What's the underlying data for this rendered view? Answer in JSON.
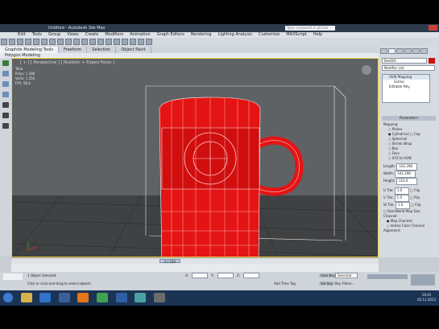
{
  "window": {
    "title": "Untitled - Autodesk 3ds Max",
    "search_placeholder": "Type a keyword or phrase"
  },
  "menu": [
    "Edit",
    "Tools",
    "Group",
    "Views",
    "Create",
    "Modifiers",
    "Animation",
    "Graph Editors",
    "Rendering",
    "Lighting Analysis",
    "Customize",
    "MAXScript",
    "Help"
  ],
  "ribbon": {
    "tabs": [
      "Graphite Modeling Tools",
      "Freeform",
      "Selection",
      "Object Paint"
    ],
    "subtab": "Polygon Modeling"
  },
  "viewport": {
    "label": "[ + ] [ Perspective ] [ Realistic + Edged Faces ]",
    "stats": [
      "Total",
      "Polys: 1 288",
      "Verts: 1 256",
      "FPS: 58.4"
    ]
  },
  "command_panel": {
    "object_name": "Box001",
    "modifier_list": "Modifier List",
    "stack": [
      "UVW Mapping",
      "Gizmo",
      "Editable Poly"
    ],
    "rollout": "Parameters",
    "mapping_title": "Mapping:",
    "mapping_options": [
      "Planar",
      "Cylindrical",
      "Cap",
      "Spherical",
      "Shrink Wrap",
      "Box",
      "Face",
      "XYZ to UVW"
    ],
    "length_label": "Length:",
    "length_value": "102.298",
    "width_label": "Width:",
    "width_value": "102.298",
    "height_label": "Height:",
    "height_value": "110.0",
    "u_tile_label": "U Tile:",
    "u_tile_value": "1.0",
    "v_tile_label": "V Tile:",
    "v_tile_value": "1.0",
    "w_tile_label": "W Tile:",
    "w_tile_value": "1.0",
    "flip": "Flip",
    "real_world": "Real-World Map Size",
    "channel_title": "Channel:",
    "map_channel": "Map Channel:",
    "vertex_color": "Vertex Color Channel",
    "alignment": "Alignment:"
  },
  "timeline": {
    "position": "0 / 100"
  },
  "status": {
    "selection": "1 Object Selected",
    "prompt": "Click or click-and-drag to select objects",
    "auto_key": "Auto Key",
    "set_key": "Set Key",
    "selected": "Selected",
    "key_filters": "Key Filters...",
    "add_time_tag": "Add Time Tag",
    "x": "X:",
    "y": "Y:",
    "z": "Z:"
  },
  "taskbar": {
    "time": "16:41",
    "date": "03.11.2013"
  },
  "colors": {
    "mug": "#e41414",
    "viewport_border": "#f2d64b",
    "taskbar": "#1c3454"
  }
}
